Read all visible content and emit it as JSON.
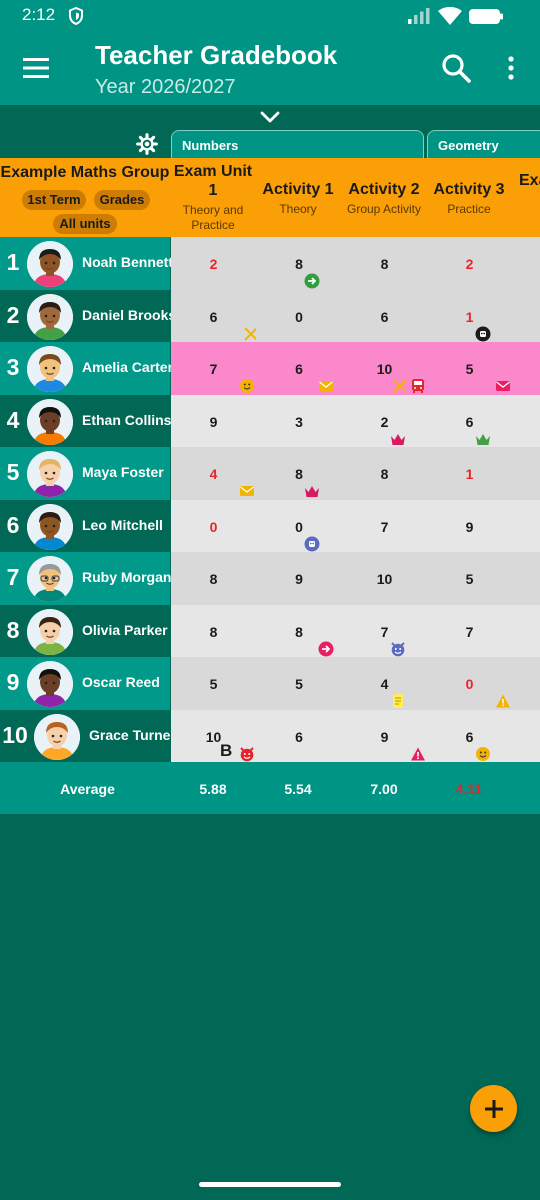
{
  "status_bar": {
    "time": "2:12"
  },
  "app_bar": {
    "title": "Teacher Gradebook",
    "subtitle": "Year 2026/2027"
  },
  "unit_tabs": [
    "Numbers",
    "Geometry"
  ],
  "header": {
    "group_name": "Example Maths Group",
    "term_chip": "1st Term",
    "grades_chip": "Grades",
    "units_chip": "All units",
    "columns": [
      {
        "line1": "Exam Unit",
        "line2": "1",
        "subtitle1": "Theory and",
        "subtitle2": "Practice"
      },
      {
        "line1": "Activity 1",
        "line2": "",
        "subtitle1": "Theory",
        "subtitle2": ""
      },
      {
        "line1": "Activity 2",
        "line2": "",
        "subtitle1": "Group Activity",
        "subtitle2": ""
      },
      {
        "line1": "Activity 3",
        "line2": "",
        "subtitle1": "Practice",
        "subtitle2": ""
      },
      {
        "line1": "Exa",
        "line2": "",
        "subtitle1": "",
        "subtitle2": ""
      }
    ]
  },
  "students": [
    {
      "num": "1",
      "name": "Noah Bennett",
      "grades": [
        "2",
        "8",
        "8",
        "2"
      ]
    },
    {
      "num": "2",
      "name": "Daniel Brooks",
      "grades": [
        "6",
        "0",
        "6",
        "1"
      ]
    },
    {
      "num": "3",
      "name": "Amelia Carter",
      "grades": [
        "7",
        "6",
        "10",
        "5"
      ]
    },
    {
      "num": "4",
      "name": "Ethan Collins",
      "grades": [
        "9",
        "3",
        "2",
        "6"
      ]
    },
    {
      "num": "5",
      "name": "Maya Foster",
      "grades": [
        "4",
        "8",
        "8",
        "1"
      ]
    },
    {
      "num": "6",
      "name": "Leo Mitchell",
      "grades": [
        "0",
        "0",
        "7",
        "9"
      ]
    },
    {
      "num": "7",
      "name": "Ruby Morgan",
      "grades": [
        "8",
        "9",
        "10",
        "5"
      ]
    },
    {
      "num": "8",
      "name": "Olivia Parker",
      "grades": [
        "8",
        "8",
        "7",
        "7"
      ]
    },
    {
      "num": "9",
      "name": "Oscar Reed",
      "grades": [
        "5",
        "5",
        "4",
        "0"
      ]
    },
    {
      "num": "10",
      "name": "Grace Turner",
      "grades": [
        "10",
        "6",
        "9",
        "6"
      ]
    }
  ],
  "notes": {
    "grace_exam_letter": "B"
  },
  "average": {
    "label": "Average",
    "values": [
      "5.88",
      "5.54",
      "7.00",
      "4.11"
    ]
  },
  "colors": {
    "primary": "#009485",
    "dark": "#016855",
    "header": "#fb9f07",
    "highlight_row": "#fb88cb",
    "failing_grade": "#e8232a"
  }
}
